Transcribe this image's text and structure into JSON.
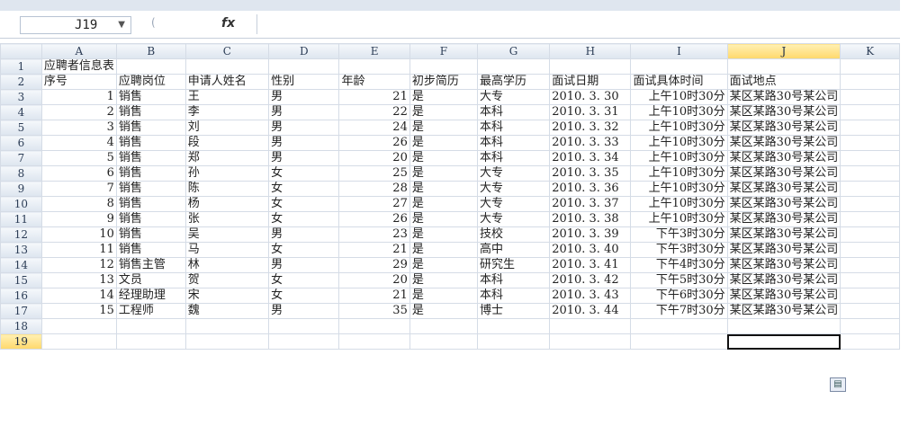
{
  "namebox": {
    "cell": "J19"
  },
  "columns": [
    "A",
    "B",
    "C",
    "D",
    "E",
    "F",
    "G",
    "H",
    "I",
    "J",
    "K"
  ],
  "active_column": "J",
  "active_row": "19",
  "rows": [
    {
      "row": "1",
      "cells": [
        "应聘者信息表",
        "",
        "",
        "",
        "",
        "",
        "",
        "",
        "",
        "",
        ""
      ]
    },
    {
      "row": "2",
      "cells": [
        "序号",
        "应聘岗位",
        "申请人姓名",
        "性别",
        "年龄",
        "初步简历",
        "最高学历",
        "面试日期",
        "面试具体时间",
        "面试地点",
        ""
      ]
    },
    {
      "row": "3",
      "cells": [
        "1",
        "销售",
        "王",
        "男",
        "21",
        "是",
        "大专",
        "2010. 3. 30",
        "上午10时30分",
        "某区某路30号某公司",
        ""
      ]
    },
    {
      "row": "4",
      "cells": [
        "2",
        "销售",
        "李",
        "男",
        "22",
        "是",
        "本科",
        "2010. 3. 31",
        "上午10时30分",
        "某区某路30号某公司",
        ""
      ]
    },
    {
      "row": "5",
      "cells": [
        "3",
        "销售",
        "刘",
        "男",
        "24",
        "是",
        "本科",
        "2010. 3. 32",
        "上午10时30分",
        "某区某路30号某公司",
        ""
      ]
    },
    {
      "row": "6",
      "cells": [
        "4",
        "销售",
        "段",
        "男",
        "26",
        "是",
        "本科",
        "2010. 3. 33",
        "上午10时30分",
        "某区某路30号某公司",
        ""
      ]
    },
    {
      "row": "7",
      "cells": [
        "5",
        "销售",
        "郑",
        "男",
        "20",
        "是",
        "本科",
        "2010. 3. 34",
        "上午10时30分",
        "某区某路30号某公司",
        ""
      ]
    },
    {
      "row": "8",
      "cells": [
        "6",
        "销售",
        "孙",
        "女",
        "25",
        "是",
        "大专",
        "2010. 3. 35",
        "上午10时30分",
        "某区某路30号某公司",
        ""
      ]
    },
    {
      "row": "9",
      "cells": [
        "7",
        "销售",
        "陈",
        "女",
        "28",
        "是",
        "大专",
        "2010. 3. 36",
        "上午10时30分",
        "某区某路30号某公司",
        ""
      ]
    },
    {
      "row": "10",
      "cells": [
        "8",
        "销售",
        "杨",
        "女",
        "27",
        "是",
        "大专",
        "2010. 3. 37",
        "上午10时30分",
        "某区某路30号某公司",
        ""
      ]
    },
    {
      "row": "11",
      "cells": [
        "9",
        "销售",
        "张",
        "女",
        "26",
        "是",
        "大专",
        "2010. 3. 38",
        "上午10时30分",
        "某区某路30号某公司",
        ""
      ]
    },
    {
      "row": "12",
      "cells": [
        "10",
        "销售",
        "吴",
        "男",
        "23",
        "是",
        "技校",
        "2010. 3. 39",
        "下午3时30分",
        "某区某路30号某公司",
        ""
      ]
    },
    {
      "row": "13",
      "cells": [
        "11",
        "销售",
        "马",
        "女",
        "21",
        "是",
        "高中",
        "2010. 3. 40",
        "下午3时30分",
        "某区某路30号某公司",
        ""
      ]
    },
    {
      "row": "14",
      "cells": [
        "12",
        "销售主管",
        "林",
        "男",
        "29",
        "是",
        "研究生",
        "2010. 3. 41",
        "下午4时30分",
        "某区某路30号某公司",
        ""
      ]
    },
    {
      "row": "15",
      "cells": [
        "13",
        "文员",
        "贺",
        "女",
        "20",
        "是",
        "本科",
        "2010. 3. 42",
        "下午5时30分",
        "某区某路30号某公司",
        ""
      ]
    },
    {
      "row": "16",
      "cells": [
        "14",
        "经理助理",
        "宋",
        "女",
        "21",
        "是",
        "本科",
        "2010. 3. 43",
        "下午6时30分",
        "某区某路30号某公司",
        ""
      ]
    },
    {
      "row": "17",
      "cells": [
        "15",
        "工程师",
        "魏",
        "男",
        "35",
        "是",
        "博士",
        "2010. 3. 44",
        "下午7时30分",
        "某区某路30号某公司",
        ""
      ]
    },
    {
      "row": "18",
      "cells": [
        "",
        "",
        "",
        "",
        "",
        "",
        "",
        "",
        "",
        "",
        ""
      ]
    },
    {
      "row": "19",
      "cells": [
        "",
        "",
        "",
        "",
        "",
        "",
        "",
        "",
        "",
        "",
        ""
      ]
    }
  ]
}
